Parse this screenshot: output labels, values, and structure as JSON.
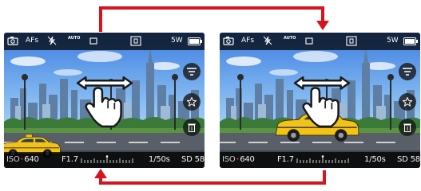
{
  "colors": {
    "accent": "#d7131d",
    "iso_mark": "#e53935",
    "cab": "#f2c216"
  },
  "screens": [
    {
      "id": "before",
      "status": {
        "af_mode": "AFs",
        "wb": "AUTO",
        "shots": "5W",
        "battery_icon": "battery-icon"
      },
      "exposure": {
        "iso_prefix": "ISO",
        "iso_value": "640",
        "aperture": "F1.7",
        "shutter": "1/50s",
        "storage": "SD 58"
      },
      "subject": "taxi-left",
      "icons": [
        "camera-mode-icon",
        "af-icon",
        "flash-off-icon",
        "wb-auto-icon",
        "drive-mode-icon",
        "af-field-icon",
        "battery-icon",
        "menu-icon",
        "star-icon",
        "trash-icon",
        "horizontal-swipe-hand-icon"
      ]
    },
    {
      "id": "after",
      "status": {
        "af_mode": "AFs",
        "wb": "AUTO",
        "shots": "5W",
        "battery_icon": "battery-icon"
      },
      "exposure": {
        "iso_prefix": "ISO",
        "iso_value": "640",
        "aperture": "F1.7",
        "shutter": "1/50s",
        "storage": "SD 58"
      },
      "subject": "taxi-center",
      "icons": [
        "camera-mode-icon",
        "af-icon",
        "flash-off-icon",
        "wb-auto-icon",
        "drive-mode-icon",
        "af-field-icon",
        "battery-icon",
        "menu-icon",
        "star-icon",
        "trash-icon",
        "horizontal-swipe-hand-icon"
      ]
    }
  ],
  "flow": {
    "top": "next-image-arrow",
    "bottom": "previous-image-arrow"
  }
}
